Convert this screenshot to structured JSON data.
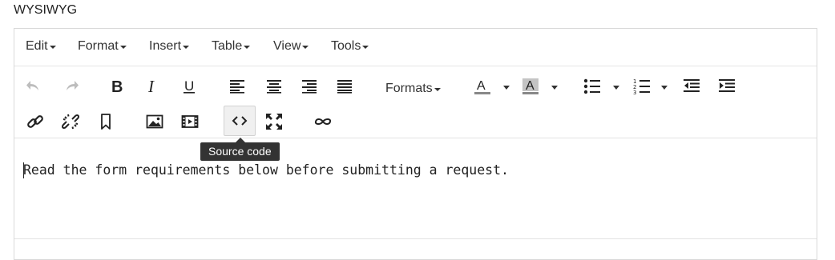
{
  "field": {
    "label": "WYSIWYG"
  },
  "menubar": {
    "items": [
      {
        "label": "Edit"
      },
      {
        "label": "Format"
      },
      {
        "label": "Insert"
      },
      {
        "label": "Table"
      },
      {
        "label": "View"
      },
      {
        "label": "Tools"
      }
    ]
  },
  "toolbar": {
    "formats_label": "Formats",
    "text_color_glyph": "A",
    "bg_color_glyph": "A",
    "text_color_accent": "#888888",
    "bg_color_accent": "#888888",
    "active_tool": "source-code"
  },
  "tooltip": {
    "text": "Source code"
  },
  "content": {
    "text": "Read the form requirements below before submitting a request."
  }
}
